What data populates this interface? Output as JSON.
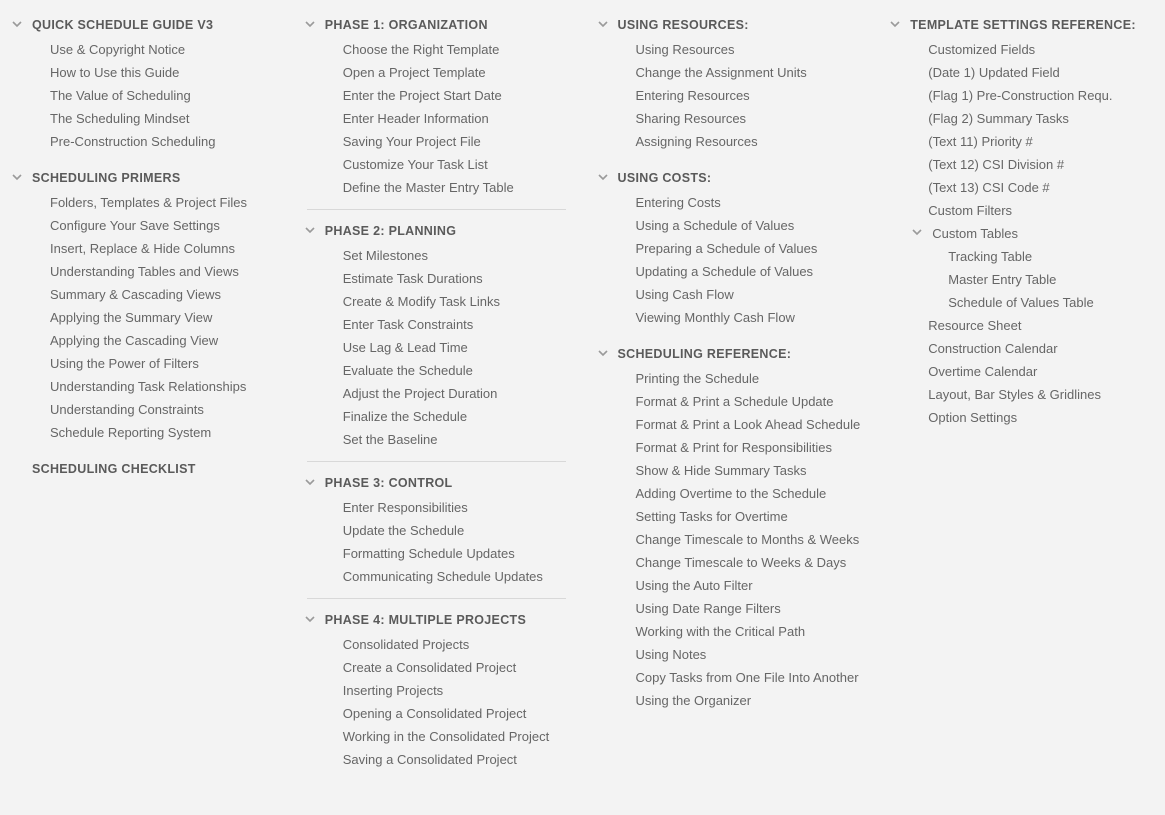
{
  "columns": [
    {
      "sections": [
        {
          "title": "QUICK SCHEDULE GUIDE V3",
          "items": [
            {
              "label": "Use & Copyright Notice"
            },
            {
              "label": "How to Use this Guide"
            },
            {
              "label": "The Value of Scheduling"
            },
            {
              "label": "The Scheduling Mindset"
            },
            {
              "label": "Pre-Construction Scheduling"
            }
          ]
        },
        {
          "title": "SCHEDULING PRIMERS",
          "items": [
            {
              "label": "Folders, Templates & Project Files"
            },
            {
              "label": "Configure Your Save Settings"
            },
            {
              "label": "Insert, Replace & Hide Columns"
            },
            {
              "label": "Understanding Tables and Views"
            },
            {
              "label": "Summary & Cascading Views"
            },
            {
              "label": "Applying the Summary View"
            },
            {
              "label": "Applying the Cascading View"
            },
            {
              "label": "Using the Power of Filters"
            },
            {
              "label": "Understanding Task Relationships"
            },
            {
              "label": "Understanding Constraints"
            },
            {
              "label": "Schedule Reporting System"
            }
          ]
        },
        {
          "title": "SCHEDULING CHECKLIST",
          "no_chevron": true,
          "items": []
        }
      ]
    },
    {
      "sections": [
        {
          "title": "PHASE 1: ORGANIZATION",
          "items": [
            {
              "label": "Choose the Right Template"
            },
            {
              "label": "Open a Project Template"
            },
            {
              "label": "Enter the Project Start Date"
            },
            {
              "label": "Enter Header Information"
            },
            {
              "label": "Saving Your Project File"
            },
            {
              "label": "Customize Your Task List"
            },
            {
              "label": "Define the Master Entry Table"
            }
          ],
          "hr_after": true
        },
        {
          "title": "PHASE 2: PLANNING",
          "items": [
            {
              "label": "Set Milestones"
            },
            {
              "label": "Estimate Task Durations"
            },
            {
              "label": "Create & Modify Task Links"
            },
            {
              "label": "Enter Task Constraints"
            },
            {
              "label": "Use Lag & Lead Time"
            },
            {
              "label": "Evaluate the Schedule"
            },
            {
              "label": "Adjust the Project Duration"
            },
            {
              "label": "Finalize the Schedule"
            },
            {
              "label": "Set the Baseline"
            }
          ],
          "hr_after": true
        },
        {
          "title": "PHASE 3: CONTROL",
          "items": [
            {
              "label": "Enter Responsibilities"
            },
            {
              "label": "Update the Schedule"
            },
            {
              "label": "Formatting Schedule Updates"
            },
            {
              "label": "Communicating Schedule Updates"
            }
          ],
          "hr_after": true
        },
        {
          "title": "PHASE 4: MULTIPLE PROJECTS",
          "items": [
            {
              "label": "Consolidated Projects"
            },
            {
              "label": "Create a Consolidated Project"
            },
            {
              "label": "Inserting Projects"
            },
            {
              "label": "Opening a Consolidated Project"
            },
            {
              "label": "Working in the Consolidated Project"
            },
            {
              "label": "Saving a Consolidated Project"
            }
          ]
        }
      ]
    },
    {
      "sections": [
        {
          "title": "USING RESOURCES:",
          "items": [
            {
              "label": "Using Resources"
            },
            {
              "label": "Change the Assignment Units"
            },
            {
              "label": "Entering Resources"
            },
            {
              "label": "Sharing Resources"
            },
            {
              "label": "Assigning Resources"
            }
          ]
        },
        {
          "title": "USING COSTS:",
          "items": [
            {
              "label": "Entering Costs"
            },
            {
              "label": "Using a Schedule of Values"
            },
            {
              "label": "Preparing a Schedule of Values"
            },
            {
              "label": "Updating a Schedule of Values"
            },
            {
              "label": "Using Cash Flow"
            },
            {
              "label": "Viewing Monthly Cash Flow"
            }
          ]
        },
        {
          "title": "SCHEDULING REFERENCE:",
          "items": [
            {
              "label": "Printing the Schedule"
            },
            {
              "label": "Format & Print a Schedule Update"
            },
            {
              "label": "Format & Print a Look Ahead Schedule"
            },
            {
              "label": "Format & Print for Responsibilities"
            },
            {
              "label": "Show & Hide Summary Tasks"
            },
            {
              "label": "Adding Overtime to the Schedule"
            },
            {
              "label": "Setting Tasks for Overtime"
            },
            {
              "label": "Change Timescale to Months & Weeks"
            },
            {
              "label": "Change Timescale to Weeks & Days"
            },
            {
              "label": "Using the Auto Filter"
            },
            {
              "label": "Using Date Range Filters"
            },
            {
              "label": "Working with the Critical Path"
            },
            {
              "label": "Using Notes"
            },
            {
              "label": "Copy Tasks from One File Into Another"
            },
            {
              "label": "Using the Organizer"
            }
          ]
        }
      ]
    },
    {
      "sections": [
        {
          "title": "TEMPLATE SETTINGS REFERENCE:",
          "items": [
            {
              "label": "Customized Fields"
            },
            {
              "label": "(Date 1) Updated Field"
            },
            {
              "label": "(Flag 1) Pre-Construction Requ."
            },
            {
              "label": "(Flag 2) Summary Tasks"
            },
            {
              "label": "(Text 11) Priority #"
            },
            {
              "label": "(Text 12) CSI Division #"
            },
            {
              "label": "(Text 13) CSI Code #"
            },
            {
              "label": "Custom Filters"
            },
            {
              "label": "Custom Tables",
              "expandable": true,
              "children": [
                {
                  "label": "Tracking Table"
                },
                {
                  "label": "Master Entry Table"
                },
                {
                  "label": "Schedule of Values Table"
                }
              ]
            },
            {
              "label": "Resource Sheet"
            },
            {
              "label": "Construction Calendar"
            },
            {
              "label": "Overtime Calendar"
            },
            {
              "label": "Layout, Bar Styles & Gridlines"
            },
            {
              "label": "Option Settings"
            }
          ]
        }
      ]
    }
  ]
}
